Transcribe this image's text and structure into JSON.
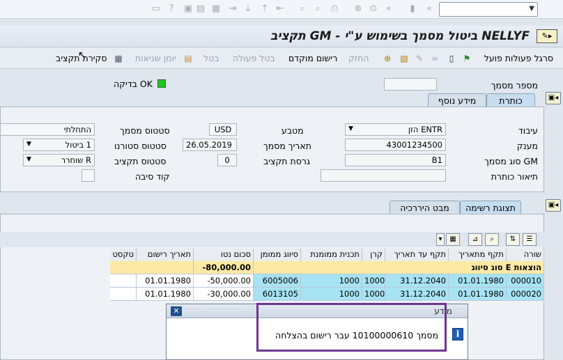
{
  "title": "תקציב GM - ביטול מסמך בשימוש ע\"י NELLYF",
  "toolbar": {
    "items": [
      "סרגל פעולות פועל",
      "החזק",
      "רישום מוקדם",
      "בטל פעולה",
      "בטל",
      "יומן שגיאות",
      "סקירת תקציב"
    ]
  },
  "doc_check": {
    "doc_number_label": "מספר מסמך",
    "doc_number_value": "",
    "check_label": "בדיקה OK"
  },
  "header_tabs": [
    "כותרת",
    "מידע נוסף"
  ],
  "header": {
    "processing_label": "עיבוד",
    "processing_value": "ENTR הזן",
    "grantor_label": "מענק",
    "grantor_value": "43001234500",
    "doc_type_label": "סוג מסמך GM",
    "doc_type_value": "B1",
    "header_desc_label": "תיאור כותרת",
    "header_desc_value": "",
    "currency_label": "מטבע",
    "currency_value": "USD",
    "doc_date_label": "תאריך מסמך",
    "doc_date_value": "26.05.2019",
    "budget_version_label": "גרסת תקציב",
    "budget_version_value": "0",
    "doc_status_label": "סטטוס מסמך",
    "doc_status_value": "התחלתי",
    "reversal_status_label": "סטטוס סטורנו",
    "reversal_status_value": "1 ביטול",
    "budget_status_label": "סטטוס תקציב",
    "budget_status_value": "R שוחרר",
    "reason_code_label": "קוד סיבה",
    "reason_code_value": ""
  },
  "list_tabs": [
    "תצוגת רשימה",
    "מבט היררכיה"
  ],
  "grid": {
    "columns": [
      "שורה",
      "תקף מתאריך",
      "תקף עד תאריך",
      "קרן",
      "תכנית ממומנת",
      "סיווג ממומן",
      "סכום נטו",
      "תאריך רישום",
      "טקסט"
    ],
    "group": {
      "label": "סוג סיווג E הוצאות",
      "amount": "-80,000.00"
    },
    "rows": [
      {
        "line": "000010",
        "from": "01.01.1980",
        "to": "31.12.2040",
        "fund": "1000",
        "program": "1000",
        "class": "6005006",
        "amount": "-50,000.00",
        "posting": "01.01.1980",
        "text": ""
      },
      {
        "line": "000020",
        "from": "01.01.1980",
        "to": "31.12.2040",
        "fund": "1000",
        "program": "1000",
        "class": "6013105",
        "amount": "-30,000.00",
        "posting": "01.01.1980",
        "text": ""
      }
    ]
  },
  "popup": {
    "caption": "מידע",
    "message": "מסמך 10100000610 עבר רישום בהצלחה"
  }
}
